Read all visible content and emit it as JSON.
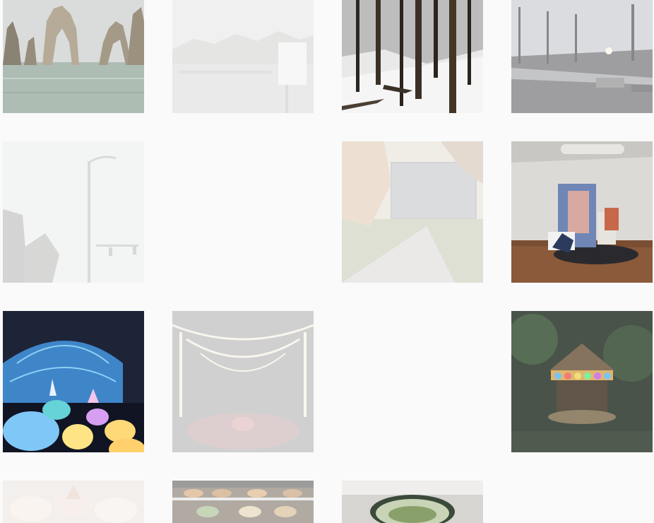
{
  "gallery": {
    "tiles": [
      {
        "id": "arches",
        "state": "loaded"
      },
      {
        "id": "harbor",
        "state": "loading"
      },
      {
        "id": "snow",
        "state": "loaded"
      },
      {
        "id": "park",
        "state": "loaded"
      },
      {
        "id": "street",
        "state": "loading"
      },
      {
        "id": "campus",
        "state": "loading"
      },
      {
        "id": "gallery",
        "state": "loaded"
      },
      {
        "id": "lanterns",
        "state": "loaded"
      },
      {
        "id": "arbor",
        "state": "loading"
      },
      {
        "id": "carousel",
        "state": "loading"
      },
      {
        "id": "pastry",
        "state": "loading"
      },
      {
        "id": "bakery",
        "state": "loading"
      },
      {
        "id": "matcha",
        "state": "loaded"
      }
    ]
  },
  "colors": {
    "background": "#fafafa",
    "loading_overlay": "rgba(250,250,250,0.55)"
  }
}
